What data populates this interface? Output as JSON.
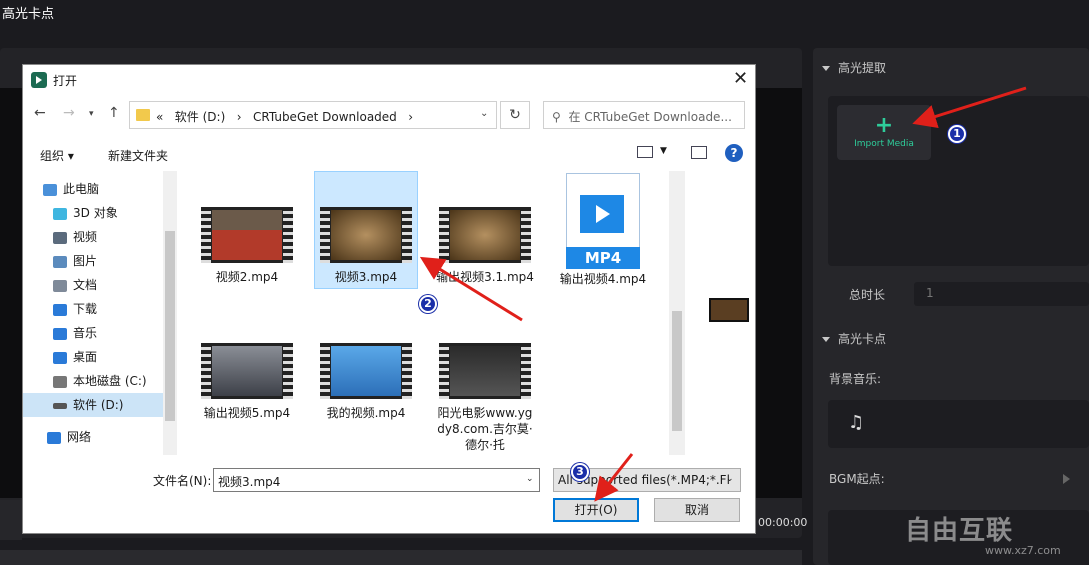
{
  "app": {
    "title": "高光卡点",
    "timecode": "00:00:00"
  },
  "right_panel": {
    "section_extract": "高光提取",
    "import_media": "Import Media",
    "total_duration_label": "总时长",
    "total_duration_value": "1",
    "section_beat": "高光卡点",
    "bgm_label": "背景音乐:",
    "bgm_start_label": "BGM起点:"
  },
  "watermark": {
    "text": "自由互联",
    "sub": "www.xz7.com"
  },
  "dialog": {
    "title": "打开",
    "breadcrumb": [
      "«",
      "软件 (D:)",
      "›",
      "CRTubeGet Downloaded",
      "›"
    ],
    "search_placeholder": "在 CRTubeGet Downloade...",
    "organize": "组织 ▾",
    "new_folder": "新建文件夹",
    "nav_items": [
      {
        "label": "此电脑",
        "icon": "computer-icon",
        "color": "#4a90d9"
      },
      {
        "label": "3D 对象",
        "icon": "3d-objects-icon",
        "color": "#3fb6e0"
      },
      {
        "label": "视频",
        "icon": "video-icon",
        "color": "#5b6b7d"
      },
      {
        "label": "图片",
        "icon": "pictures-icon",
        "color": "#5b8bbd"
      },
      {
        "label": "文档",
        "icon": "documents-icon",
        "color": "#7f8a99"
      },
      {
        "label": "下载",
        "icon": "download-icon",
        "color": "#2a7ad8"
      },
      {
        "label": "音乐",
        "icon": "music-icon",
        "color": "#2a7ad8"
      },
      {
        "label": "桌面",
        "icon": "desktop-icon",
        "color": "#2a7ad8"
      },
      {
        "label": "本地磁盘 (C:)",
        "icon": "drive-c-icon",
        "color": "#777777"
      },
      {
        "label": "软件 (D:)",
        "icon": "drive-d-icon",
        "color": "#555555"
      },
      {
        "label": "网络",
        "icon": "network-icon",
        "color": "#2a7ad8"
      }
    ],
    "files": [
      {
        "name": "视频2.mp4",
        "thumb": "video-thumbnail-red"
      },
      {
        "name": "视频3.mp4",
        "thumb": "video-thumbnail-gold"
      },
      {
        "name": "输出视频3.1.mp4",
        "thumb": "video-thumbnail-gold"
      },
      {
        "name": "输出视频4.mp4",
        "thumb": "mp4-file-icon",
        "tag": "MP4"
      },
      {
        "name": "输出视频5.mp4",
        "thumb": "video-thumbnail-grey"
      },
      {
        "name": "我的视频.mp4",
        "thumb": "video-thumbnail-blue"
      },
      {
        "name": "阳光电影www.ygdy8.com.吉尔莫·德尔·托",
        "thumb": "video-thumbnail-dark"
      }
    ],
    "filename_label": "文件名(N):",
    "filename_value": "视频3.mp4",
    "filetype_value": "All supported files(*.MP4;*.Fl",
    "open_button": "打开(O)",
    "cancel_button": "取消"
  },
  "annotations": [
    "1",
    "2",
    "3"
  ],
  "colors": {
    "accent": "#2ecc9a",
    "badge": "#1a2ea8",
    "arrow": "#e0201a",
    "selection": "#cce8ff"
  }
}
